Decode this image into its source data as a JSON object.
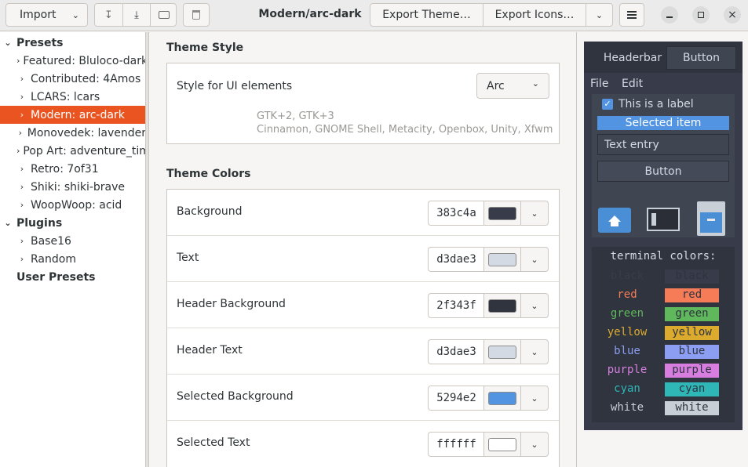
{
  "header": {
    "import_label": "Import",
    "title": "Modern/arc-dark",
    "export_theme_label": "Export Theme…",
    "export_icons_label": "Export Icons…"
  },
  "sidebar": {
    "presets_label": "Presets",
    "items": [
      {
        "label": "Featured: Bluloco-dark"
      },
      {
        "label": "Contributed: 4Amos"
      },
      {
        "label": "LCARS: lcars"
      },
      {
        "label": "Modern: arc-dark"
      },
      {
        "label": "Monovedek: lavender"
      },
      {
        "label": "Pop Art: adventure_time"
      },
      {
        "label": "Retro: 7of31"
      },
      {
        "label": "Shiki: shiki-brave"
      },
      {
        "label": "WoopWoop: acid"
      }
    ],
    "plugins_label": "Plugins",
    "plugins": [
      {
        "label": "Base16"
      },
      {
        "label": "Random"
      }
    ],
    "user_presets_label": "User Presets"
  },
  "theme_style": {
    "title": "Theme Style",
    "row_label": "Style for UI elements",
    "selected": "Arc",
    "desc_line1": "GTK+2, GTK+3",
    "desc_line2": "Cinnamon, GNOME Shell, Metacity, Openbox, Unity, Xfwm"
  },
  "theme_colors": {
    "title": "Theme Colors",
    "rows": [
      {
        "label": "Background",
        "hex": "383c4a",
        "color": "#383c4a"
      },
      {
        "label": "Text",
        "hex": "d3dae3",
        "color": "#d3dae3"
      },
      {
        "label": "Header Background",
        "hex": "2f343f",
        "color": "#2f343f"
      },
      {
        "label": "Header Text",
        "hex": "d3dae3",
        "color": "#d3dae3"
      },
      {
        "label": "Selected Background",
        "hex": "5294e2",
        "color": "#5294e2"
      },
      {
        "label": "Selected Text",
        "hex": "ffffff",
        "color": "#ffffff"
      }
    ]
  },
  "preview": {
    "tab_headerbar": "Headerbar",
    "tab_button": "Button",
    "menu_file": "File",
    "menu_edit": "Edit",
    "check_label": "This is a label",
    "selected_item": "Selected item",
    "text_entry": "Text entry",
    "button": "Button",
    "terminal_title": "terminal colors:",
    "terminal": [
      {
        "name": "black",
        "color": "#383c4a"
      },
      {
        "name": "red",
        "color": "#f67c58"
      },
      {
        "name": "green",
        "color": "#5fb85b"
      },
      {
        "name": "yellow",
        "color": "#dcab2e"
      },
      {
        "name": "blue",
        "color": "#8c9ef2"
      },
      {
        "name": "purple",
        "color": "#d77ee0"
      },
      {
        "name": "cyan",
        "color": "#2fb6b6"
      },
      {
        "name": "white",
        "color": "#c8cfd6"
      }
    ]
  },
  "colors": {
    "accent": "#e95420",
    "selected_blue": "#5294e2"
  }
}
